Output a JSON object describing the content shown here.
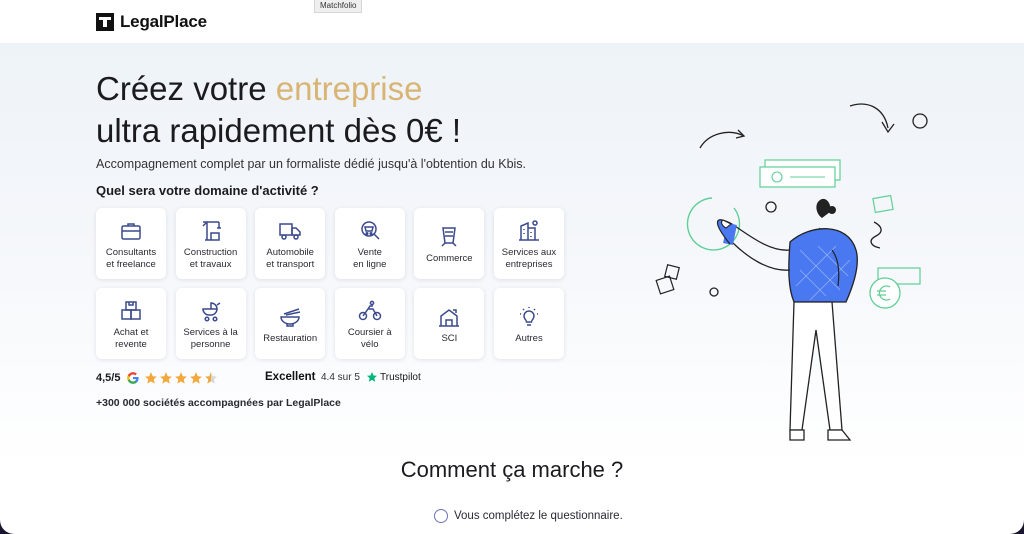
{
  "tooltip": "Matchfolio",
  "header": {
    "logo_text": "LegalPlace"
  },
  "hero": {
    "title_part1": "Créez votre ",
    "title_accent": "entreprise",
    "title_line2": "ultra rapidement dès 0€ !",
    "subtitle": "Accompagnement complet par un formaliste dédié jusqu'à l'obtention du Kbis.",
    "question": "Quel sera votre domaine d'activité ?"
  },
  "domains": [
    {
      "label": "Consultants\net freelance",
      "icon": "briefcase-icon"
    },
    {
      "label": "Construction\net travaux",
      "icon": "crane-icon"
    },
    {
      "label": "Automobile\net transport",
      "icon": "truck-icon"
    },
    {
      "label": "Vente\nen ligne",
      "icon": "cart-icon"
    },
    {
      "label": "Commerce",
      "icon": "shop-sign-icon"
    },
    {
      "label": "Services aux\nentreprises",
      "icon": "office-building-icon"
    },
    {
      "label": "Achat et\nrevente",
      "icon": "boxes-icon"
    },
    {
      "label": "Services à la\npersonne",
      "icon": "stroller-icon"
    },
    {
      "label": "Restauration",
      "icon": "noodle-bowl-icon"
    },
    {
      "label": "Coursier à\nvélo",
      "icon": "bike-courier-icon"
    },
    {
      "label": "SCI",
      "icon": "house-icon"
    },
    {
      "label": "Autres",
      "icon": "lightbulb-icon"
    }
  ],
  "ratings": {
    "google_score": "4,5/5",
    "google_stars": 4.5,
    "trustpilot_label": "Excellent",
    "trustpilot_score": "4.4 sur 5",
    "trustpilot_brand": "Trustpilot",
    "companies": "+300 000 sociétés accompagnées par LegalPlace"
  },
  "how": {
    "title": "Comment ça marche ?",
    "step1": "Vous complétez le questionnaire."
  },
  "colors": {
    "accent": "#d8b574",
    "icons": "#3a4a8c",
    "star": "#f2a83b",
    "trustpilot": "#00b67a",
    "illustration_blue": "#4a78f0",
    "illustration_green": "#5fcf95"
  }
}
